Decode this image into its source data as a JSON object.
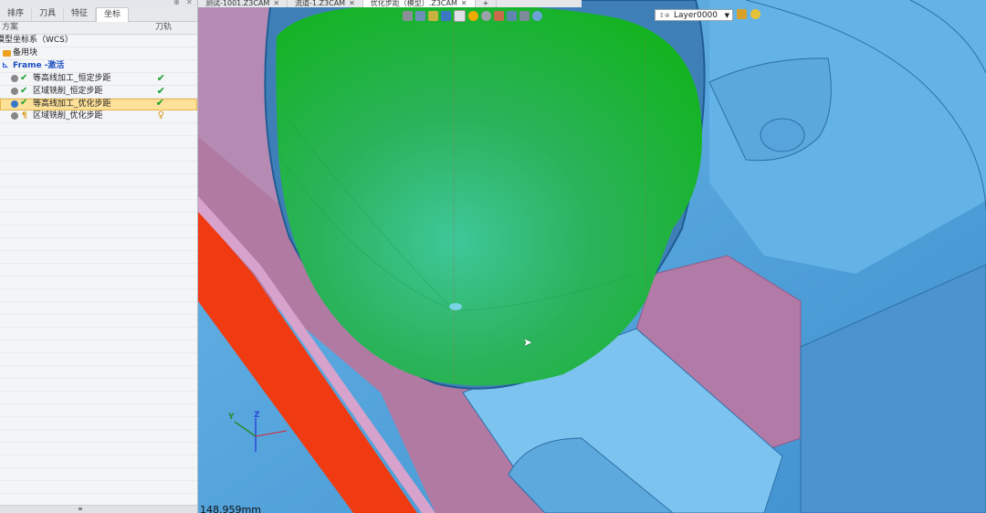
{
  "left_panel": {
    "tabs": [
      {
        "label": "排序",
        "active": false
      },
      {
        "label": "刀具",
        "active": false
      },
      {
        "label": "特征",
        "active": false
      },
      {
        "label": "坐标",
        "active": true
      }
    ],
    "columns": {
      "name": "方案",
      "toolpath": "刀轨"
    },
    "tree": {
      "wcs_label": "模型坐标系（WCS）",
      "spare_label": "备用块",
      "frame_label": "Frame -激活",
      "operations": [
        {
          "label": "等高线加工_恒定步距",
          "status": "done"
        },
        {
          "label": "区域铣削_恒定步距",
          "status": "done"
        },
        {
          "label": "等高线加工_优化步距",
          "status": "done",
          "selected": true
        },
        {
          "label": "区域铣削_优化步距",
          "status": "pending"
        }
      ]
    }
  },
  "viewport": {
    "doc_tabs": [
      {
        "label": "测试-1001.Z3CAM",
        "active": false
      },
      {
        "label": "流道-1.Z3CAM",
        "active": false
      },
      {
        "label": "优化步距（模型）.Z3CAM",
        "active": true
      }
    ],
    "layer_value": "Layer0000",
    "measure_readout": "148.959mm",
    "axis_labels": {
      "z": "Z",
      "y": "Y"
    }
  },
  "colors": {
    "toolpath_green": "#18b52b",
    "model_blue": "#5aa8df",
    "wall_pink": "#b77fa6",
    "red_face": "#f03a12",
    "selection_bg": "#fde199"
  }
}
